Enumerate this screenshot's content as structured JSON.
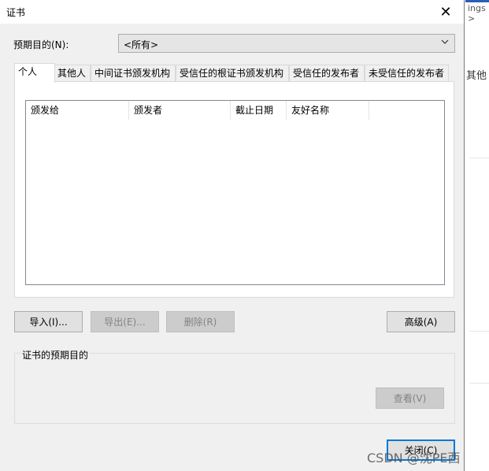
{
  "window": {
    "title": "证书",
    "close_glyph": "✕"
  },
  "purpose": {
    "label": "预期目的(N):",
    "selected": "<所有>"
  },
  "tabs": [
    {
      "label": "个人",
      "active": true
    },
    {
      "label": "其他人"
    },
    {
      "label": "中间证书颁发机构"
    },
    {
      "label": "受信任的根证书颁发机构"
    },
    {
      "label": "受信任的发布者"
    },
    {
      "label": "未受信任的发布者"
    }
  ],
  "columns": [
    "颁发给",
    "颁发者",
    "截止日期",
    "友好名称"
  ],
  "buttons": {
    "import": "导入(I)...",
    "export": "导出(E)...",
    "remove": "删除(R)",
    "advanced": "高级(A)",
    "view": "查看(V)",
    "close": "关闭(C)"
  },
  "group": {
    "label": "证书的预期目的"
  },
  "background": {
    "right_text": "其他",
    "top_text": "ings >"
  },
  "watermark": "CSDN @沈PE西"
}
